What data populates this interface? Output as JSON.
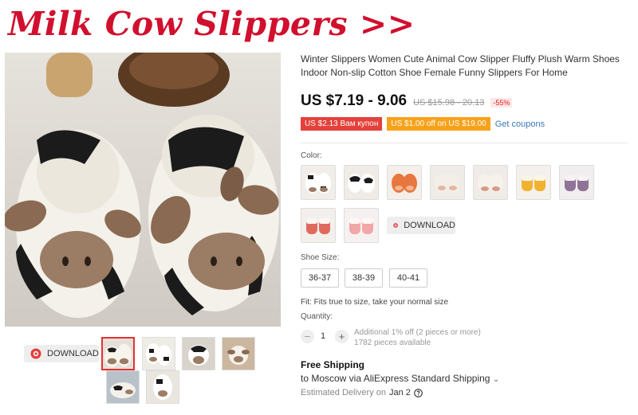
{
  "banner": {
    "text": "Milk Cow Slippers >>"
  },
  "product": {
    "title": "Winter Slippers Women Cute Animal Cow Slipper Fluffy Plush Warm Shoes Indoor Non-slip Cotton Shoe Female Funny Slippers For Home",
    "price": "US $7.19 - 9.06",
    "old_price": "US $15.98 - 20.13",
    "discount": "-55%"
  },
  "coupons": {
    "red": "US $2.13 Вам купон",
    "orange": "US $1.00 off on US $19.00",
    "link": "Get coupons"
  },
  "download": {
    "label": "DOWNLOAD"
  },
  "color": {
    "label": "Color:"
  },
  "size": {
    "label": "Shoe Size:",
    "options": [
      "36-37",
      "38-39",
      "40-41"
    ],
    "fit_note": "Fit: Fits true to size, take your normal size"
  },
  "quantity": {
    "label": "Quantity:",
    "minus": "−",
    "plus": "+",
    "value": "1",
    "note_offer": "Additional 1% off (2 pieces or more)",
    "note_stock": "1782 pieces available"
  },
  "shipping": {
    "title": "Free Shipping",
    "line": "to Moscow via AliExpress Standard Shipping",
    "chevron": "⌄",
    "delivery_label": "Estimated Delivery on",
    "delivery_date": "Jan 2"
  },
  "colors": {
    "price": "#111111",
    "discount": "#e02020",
    "coupon_red": "#e3413a",
    "coupon_orange": "#f7a21b",
    "link": "#3a7ab8",
    "banner": "#d10f2e"
  },
  "icons": {
    "download": "download-icon",
    "help": "help-icon"
  }
}
